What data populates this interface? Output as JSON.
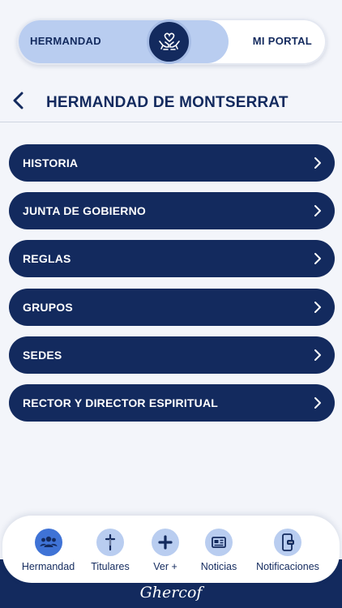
{
  "toggle": {
    "left_label": "HERMANDAD",
    "right_label": "MI PORTAL",
    "knob_icon": "heart-hands-icon"
  },
  "header": {
    "title": "HERMANDAD DE MONTSERRAT",
    "back_icon": "chevron-left-icon"
  },
  "menu": {
    "items": [
      {
        "label": "HISTORIA"
      },
      {
        "label": "JUNTA DE GOBIERNO"
      },
      {
        "label": "REGLAS"
      },
      {
        "label": "GRUPOS"
      },
      {
        "label": "SEDES"
      },
      {
        "label": "RECTOR Y DIRECTOR ESPIRITUAL"
      }
    ],
    "chevron_icon": "chevron-right-icon"
  },
  "tabbar": {
    "tabs": [
      {
        "label": "Hermandad",
        "icon": "people-group-icon"
      },
      {
        "label": "Titulares",
        "icon": "cross-icon"
      },
      {
        "label": "Ver +",
        "icon": "plus-icon"
      },
      {
        "label": "Noticias",
        "icon": "newspaper-icon"
      },
      {
        "label": "Notificaciones",
        "icon": "phone-notification-icon"
      }
    ]
  },
  "brand": {
    "text": "Ghercof"
  },
  "colors": {
    "navy": "#132a5e",
    "light_blue": "#b9cdf0",
    "background": "#f3f5fa"
  }
}
